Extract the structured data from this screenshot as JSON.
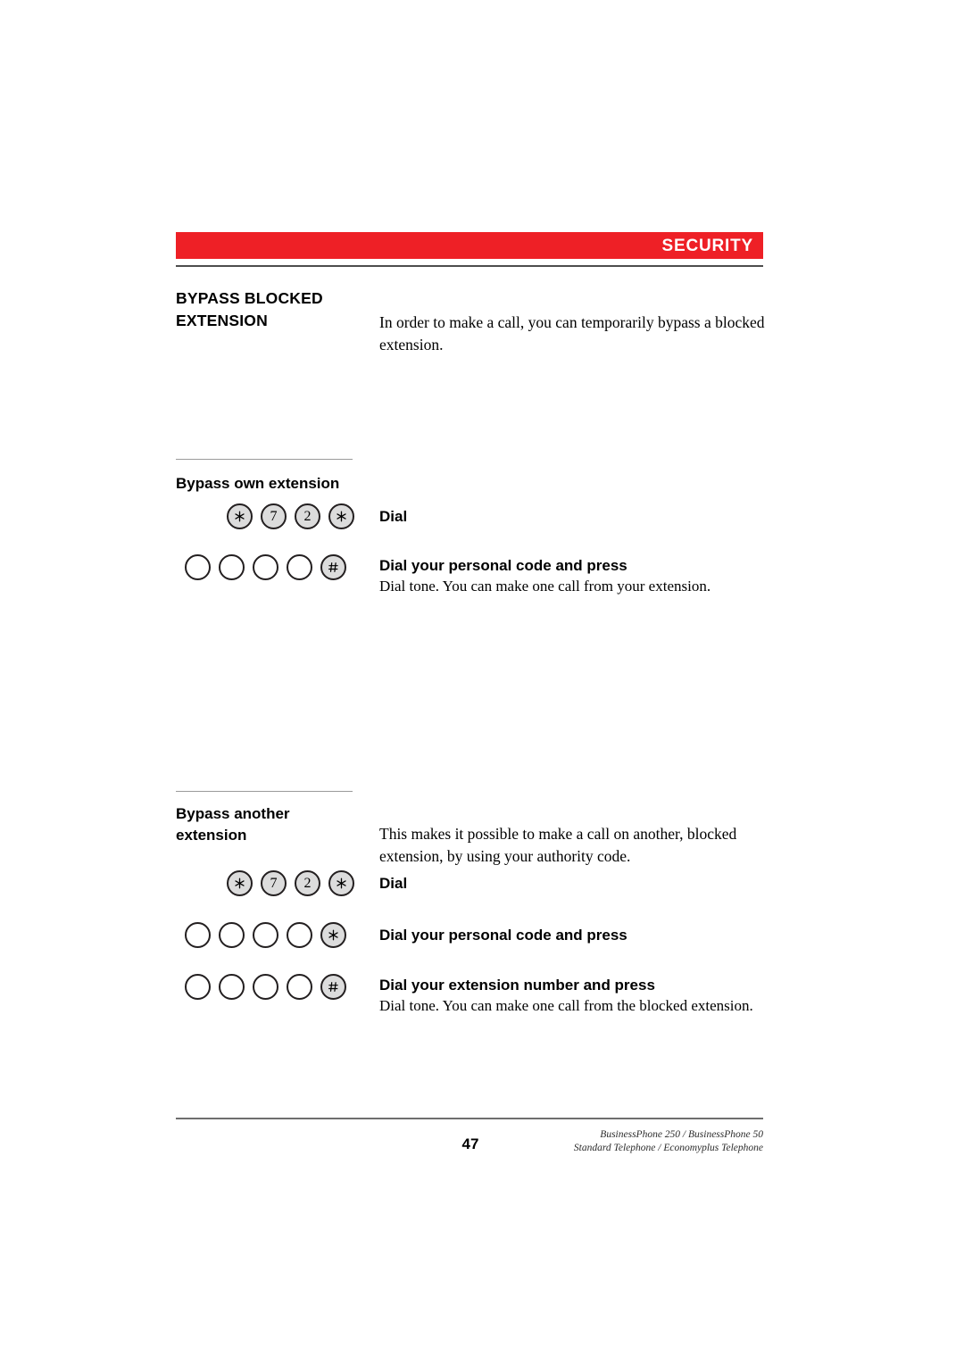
{
  "header": {
    "section_label": "SECURITY",
    "bar_color": "#ee2026"
  },
  "sections": [
    {
      "title_line1": "BYPASS BLOCKED",
      "title_line2": "EXTENSION",
      "intro": "In order to make a call, you can temporarily bypass a blocked extension."
    }
  ],
  "sub1": {
    "heading": "Bypass own extension",
    "step1": {
      "label": "Dial",
      "keys": [
        "asterisk",
        "7",
        "2",
        "asterisk"
      ]
    },
    "step2": {
      "label": "Dial your personal code and press",
      "note": "Dial tone. You can make one call from your extension.",
      "keys": [
        "blank",
        "blank",
        "blank",
        "blank",
        "hash"
      ]
    }
  },
  "sub2": {
    "heading_line1": "Bypass another",
    "heading_line2": "extension",
    "intro": "This makes it possible to make a call on another, blocked extension, by using your authority code.",
    "step1": {
      "label": "Dial",
      "keys": [
        "asterisk",
        "7",
        "2",
        "asterisk"
      ]
    },
    "step2": {
      "label": "Dial your personal code and press",
      "keys": [
        "blank",
        "blank",
        "blank",
        "blank",
        "asterisk"
      ]
    },
    "step3": {
      "label": "Dial your extension number and press",
      "note": "Dial tone. You can make one call from the blocked extension.",
      "keys": [
        "blank",
        "blank",
        "blank",
        "blank",
        "hash"
      ]
    }
  },
  "footer": {
    "page_number": "47",
    "product_line": "BusinessPhone 250 / BusinessPhone 50",
    "model_line": "Standard Telephone / Economyplus Telephone"
  }
}
